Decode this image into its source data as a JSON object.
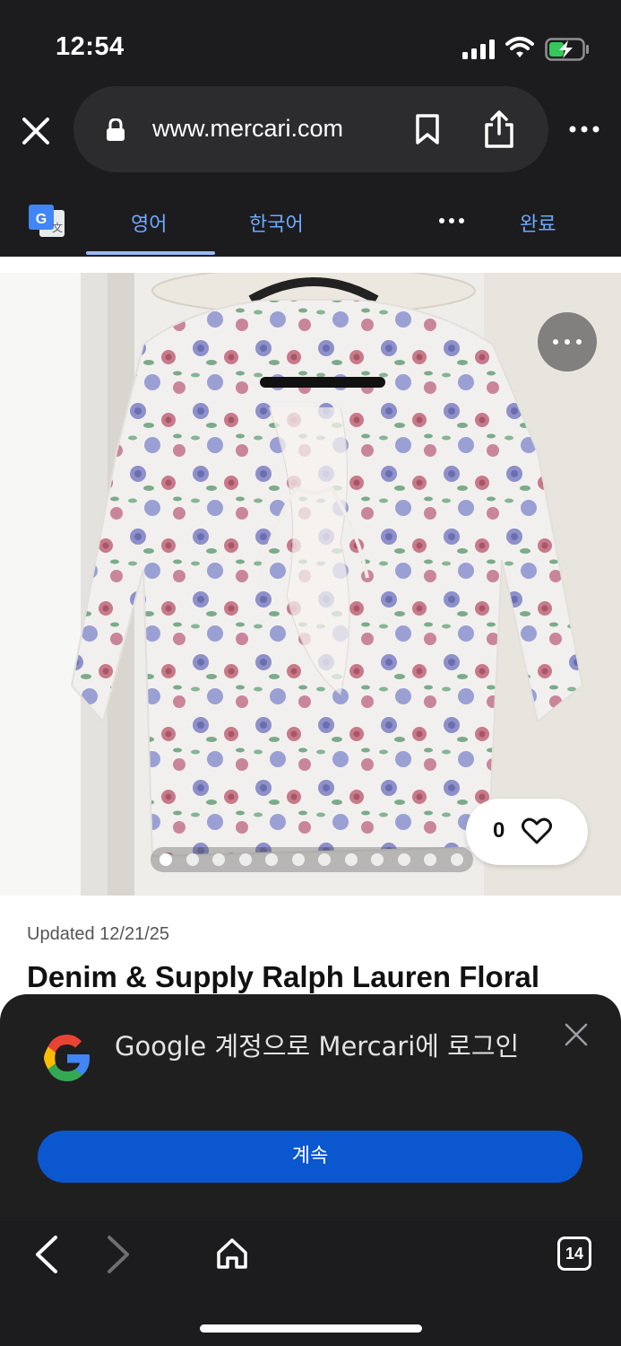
{
  "status_bar": {
    "time": "12:54"
  },
  "browser": {
    "url": "www.mercari.com"
  },
  "translate_bar": {
    "source_lang": "영어",
    "target_lang": "한국어",
    "done_label": "완료"
  },
  "product": {
    "updated": "Updated 12/21/25",
    "title": "Denim & Supply Ralph Lauren Floral",
    "like_count": "0",
    "photo_count": 12,
    "active_photo": 1
  },
  "google_signin": {
    "message": "Google 계정으로 Mercari에 로그인",
    "continue_label": "계속"
  },
  "bottom_toolbar": {
    "tab_count": "14"
  },
  "colors": {
    "chrome_bg": "#1c1c1e",
    "link_blue": "#6fa8ff",
    "google_button": "#0b57d0"
  }
}
